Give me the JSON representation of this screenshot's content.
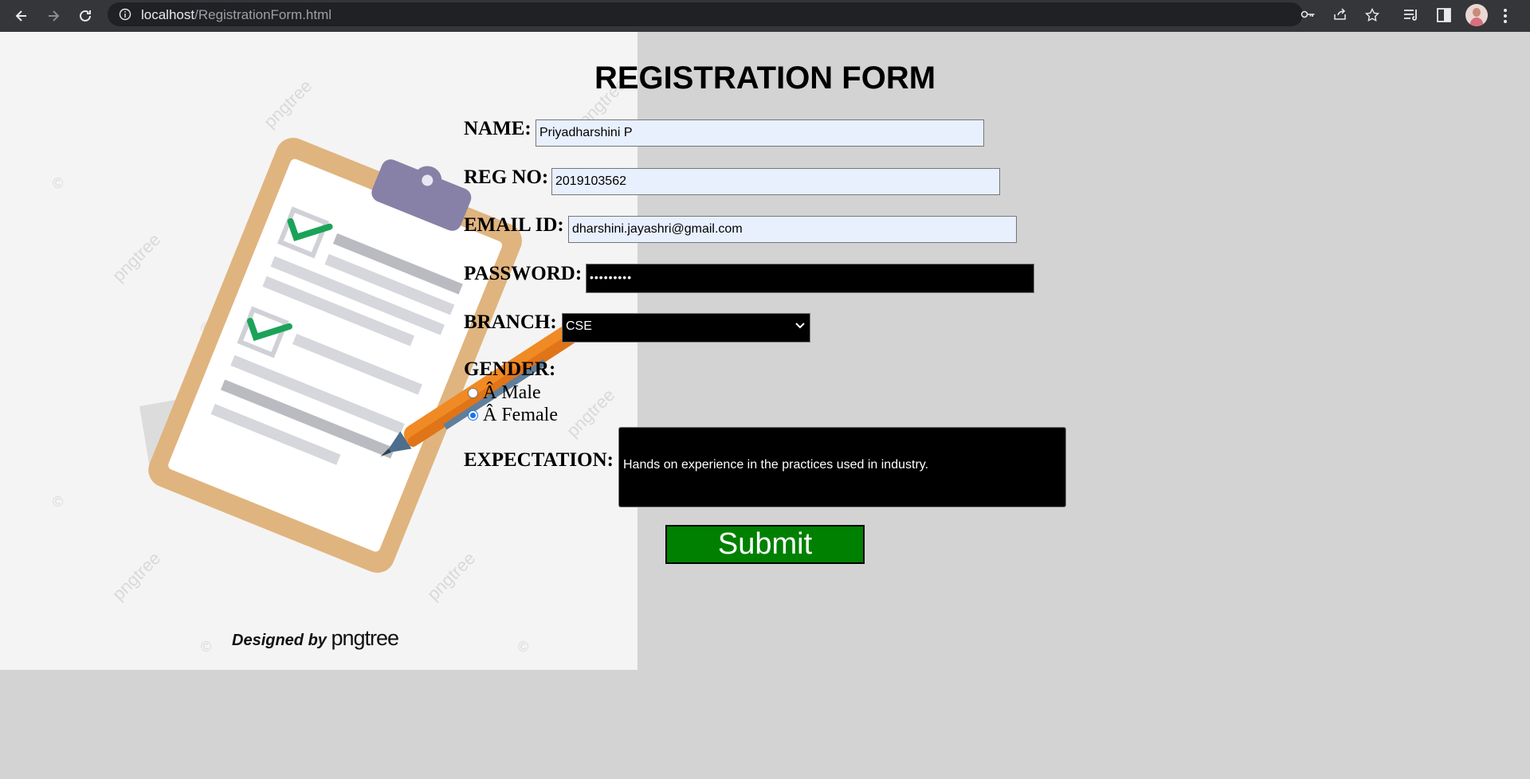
{
  "browser": {
    "url_host": "localhost",
    "url_path": "/RegistrationForm.html"
  },
  "side_image": {
    "watermark": "pngtree",
    "copyright_mark": "©",
    "credit_prefix": "Designed by",
    "credit_brand": "pngtree"
  },
  "form": {
    "title": "REGISTRATION FORM",
    "name_label": "NAME:",
    "name_value": "Priyadharshini P",
    "regno_label": "REG NO:",
    "regno_value": "2019103562",
    "email_label": "EMAIL ID:",
    "email_value": "dharshini.jayashri@gmail.com",
    "password_label": "PASSWORD:",
    "password_mask": "•••••••••",
    "branch_label": "BRANCH:",
    "branch_selected": "CSE",
    "gender_label": "GENDER:",
    "gender_options": [
      {
        "label": "Â  Male",
        "checked": false
      },
      {
        "label": "Â  Female",
        "checked": true
      }
    ],
    "expectation_label": "EXPECTATION:",
    "expectation_value": "Hands on experience in the practices used in industry.",
    "submit_label": "Submit"
  },
  "colors": {
    "page_bg": "#d3d3d3",
    "submit_bg": "#008000",
    "autofill_bg": "#e8f0fe",
    "dark_field_bg": "#000000"
  }
}
